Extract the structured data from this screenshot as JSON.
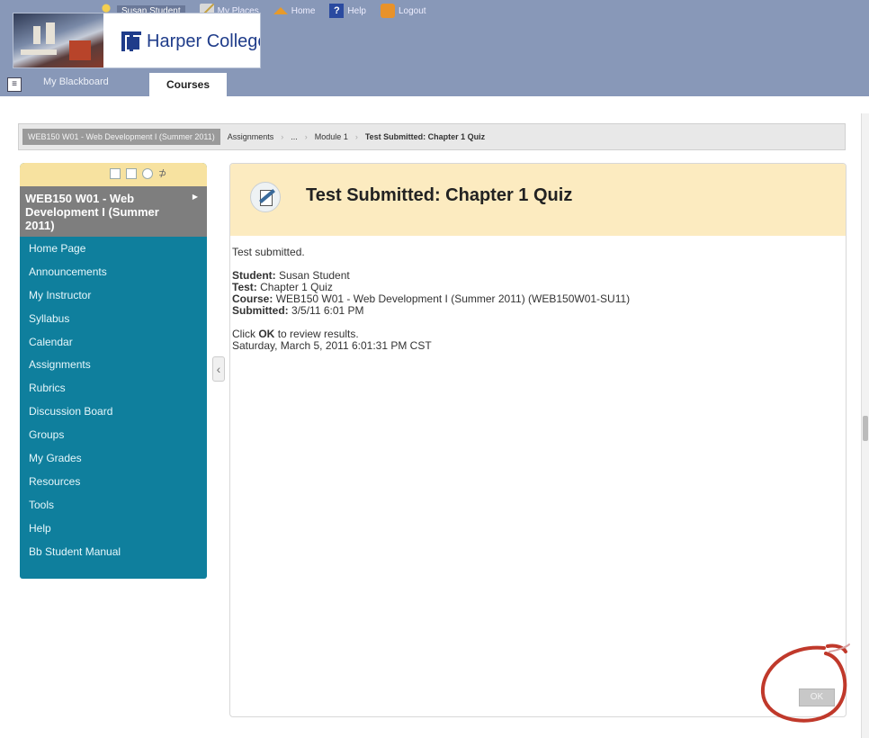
{
  "header": {
    "user_name": "Susan Student",
    "my_places": "My Places",
    "home": "Home",
    "help": "Help",
    "logout": "Logout",
    "institution": "Harper College"
  },
  "tabs": {
    "my_blackboard": "My Blackboard",
    "courses": "Courses"
  },
  "breadcrumb": {
    "course": "WEB150 W01 - Web Development I (Summer 2011)",
    "assignments": "Assignments",
    "ellipsis": "...",
    "module": "Module 1",
    "current": "Test Submitted: Chapter 1 Quiz",
    "separator": "›"
  },
  "course_menu": {
    "title": "WEB150 W01 - Web Development I (Summer 2011)",
    "items": [
      {
        "label": "Home Page"
      },
      {
        "label": "Announcements"
      },
      {
        "label": "My Instructor"
      },
      {
        "label": "Syllabus"
      },
      {
        "label": "Calendar"
      },
      {
        "label": "Assignments"
      },
      {
        "label": "Rubrics"
      },
      {
        "label": "Discussion Board"
      },
      {
        "label": "Groups"
      },
      {
        "label": "My Grades"
      },
      {
        "label": "Resources"
      },
      {
        "label": "Tools"
      },
      {
        "label": "Help"
      },
      {
        "label": "Bb Student Manual"
      }
    ]
  },
  "content": {
    "title": "Test Submitted: Chapter 1 Quiz",
    "status": "Test submitted.",
    "student_label": "Student:",
    "student_value": "Susan Student",
    "test_label": "Test:",
    "test_value": "Chapter 1 Quiz",
    "course_label": "Course:",
    "course_value": "WEB150 W01 - Web Development I (Summer 2011) (WEB150W01-SU11)",
    "submitted_label": "Submitted:",
    "submitted_value": "3/5/11 6:01 PM",
    "instruction_pre": "Click",
    "instruction_bold": "OK",
    "instruction_post": "to review results.",
    "timestamp": "Saturday, March 5, 2011 6:01:31 PM CST",
    "ok_label": "OK"
  },
  "colors": {
    "header_band": "#8898b8",
    "menu_bg": "#0f7f9d",
    "content_header_bg": "#fcebc0",
    "annotation_circle": "#c0392b"
  }
}
